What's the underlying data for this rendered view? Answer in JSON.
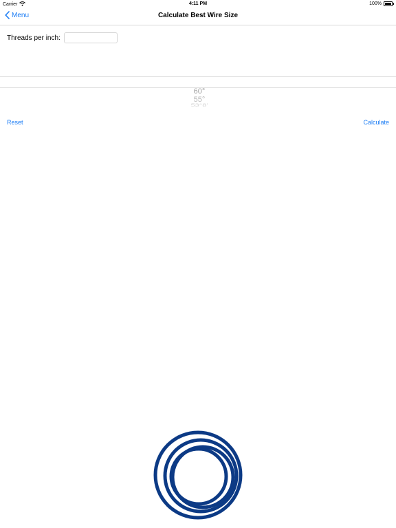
{
  "status_bar": {
    "carrier": "Carrier",
    "time": "4:11 PM",
    "battery": "100%"
  },
  "nav": {
    "back_label": "Menu",
    "title": "Calculate Best Wire Size"
  },
  "form": {
    "threads_label": "Threads per inch:",
    "threads_value": "",
    "threads_placeholder": ""
  },
  "picker": {
    "options": [
      "60°",
      "55°",
      "53°8'"
    ]
  },
  "actions": {
    "reset_label": "Reset",
    "calculate_label": "Calculate"
  },
  "colors": {
    "accent": "#1a7cf5",
    "logo": "#0c3a85"
  },
  "icons": {
    "back": "chevron-left-icon",
    "wifi": "wifi-icon",
    "battery": "battery-icon",
    "logo": "concentric-rings-logo"
  }
}
